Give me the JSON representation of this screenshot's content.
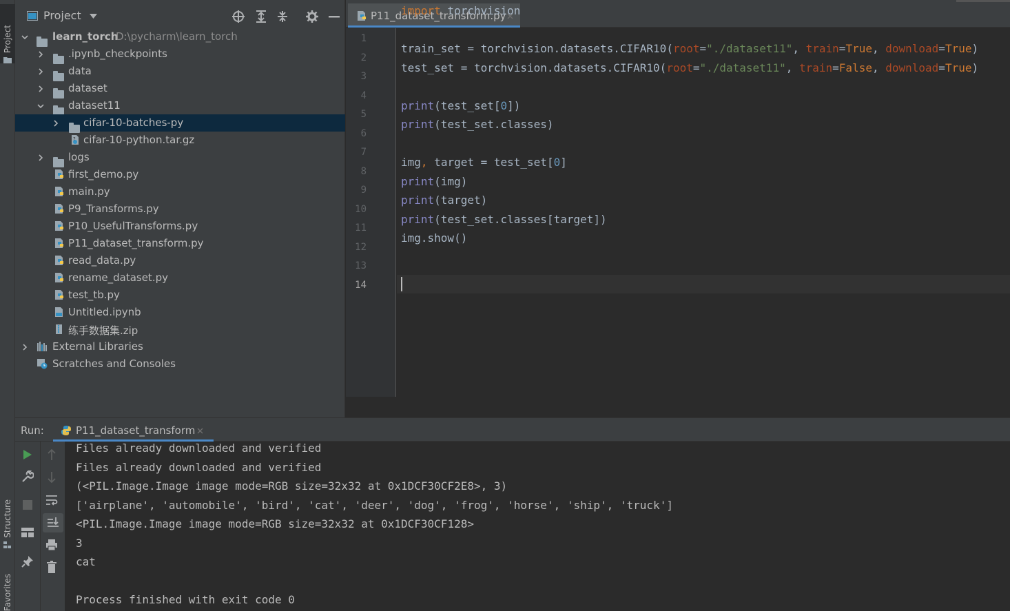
{
  "left_strip": {
    "project_tab": "Project",
    "structure_tab": "Structure",
    "favorites_tab": "Favorites"
  },
  "project_panel": {
    "title": "Project",
    "tree": [
      {
        "label": "learn_torch",
        "path": "D:\\pycharm\\learn_torch",
        "type": "root",
        "expanded": true
      },
      {
        "label": ".ipynb_checkpoints",
        "type": "folder",
        "expanded": false
      },
      {
        "label": "data",
        "type": "folder",
        "expanded": false
      },
      {
        "label": "dataset",
        "type": "folder",
        "expanded": false
      },
      {
        "label": "dataset11",
        "type": "folder",
        "expanded": true
      },
      {
        "label": "cifar-10-batches-py",
        "type": "folder",
        "expanded": false,
        "selected": true
      },
      {
        "label": "cifar-10-python.tar.gz",
        "type": "archive"
      },
      {
        "label": "logs",
        "type": "folder",
        "expanded": false
      },
      {
        "label": "first_demo.py",
        "type": "python"
      },
      {
        "label": "main.py",
        "type": "python"
      },
      {
        "label": "P9_Transforms.py",
        "type": "python"
      },
      {
        "label": "P10_UsefulTransforms.py",
        "type": "python"
      },
      {
        "label": "P11_dataset_transform.py",
        "type": "python"
      },
      {
        "label": "read_data.py",
        "type": "python"
      },
      {
        "label": "rename_dataset.py",
        "type": "python"
      },
      {
        "label": "test_tb.py",
        "type": "python"
      },
      {
        "label": "Untitled.ipynb",
        "type": "notebook"
      },
      {
        "label": "练手数据集.zip",
        "type": "zip"
      },
      {
        "label": "External Libraries",
        "type": "libraries",
        "expanded": false
      },
      {
        "label": "Scratches and Consoles",
        "type": "scratches"
      }
    ]
  },
  "editor": {
    "tab_label": "P11_dataset_transform.py",
    "line_numbers": [
      "1",
      "2",
      "3",
      "4",
      "5",
      "6",
      "7",
      "8",
      "9",
      "10",
      "11",
      "12",
      "13",
      "14"
    ],
    "current_line": "14"
  },
  "run_panel": {
    "label": "Run:",
    "tab_label": "P11_dataset_transform",
    "output": [
      "Files already downloaded and verified",
      "Files already downloaded and verified",
      "(<PIL.Image.Image image mode=RGB size=32x32 at 0x1DCF30CF2E8>, 3)",
      "['airplane', 'automobile', 'bird', 'cat', 'deer', 'dog', 'frog', 'horse', 'ship', 'truck']",
      "<PIL.Image.Image image mode=RGB size=32x32 at 0x1DCF30CF128>",
      "3",
      "cat",
      "",
      "Process finished with exit code 0"
    ]
  },
  "colors": {
    "keyword": "#cc7832",
    "builtin": "#8888c6",
    "string": "#6a8759",
    "number": "#6897bb",
    "param": "#aa4926",
    "selection": "#0d293e",
    "tab_underline": "#4a88c7"
  }
}
